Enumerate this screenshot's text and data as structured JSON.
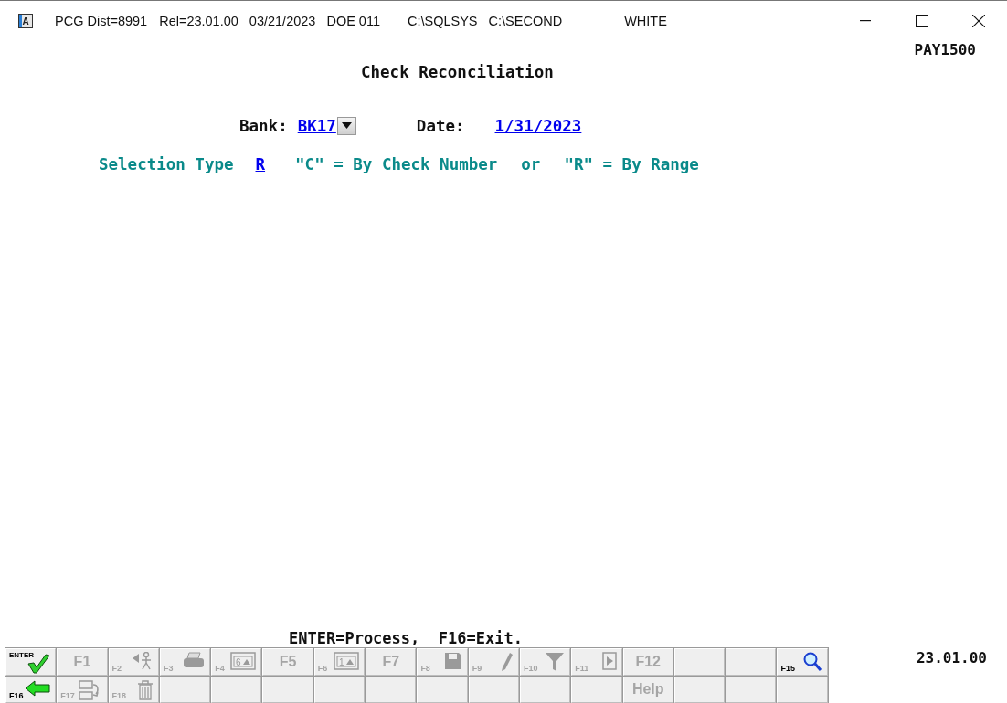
{
  "window": {
    "icon_letter": "A",
    "title_items": [
      "PCG Dist=8991",
      "Rel=23.01.00",
      "03/21/2023",
      "DOE 011",
      "C:\\SQLSYS",
      "C:\\SECOND",
      "WHITE"
    ]
  },
  "screen": {
    "program_code": "PAY1500",
    "title": "Check Reconciliation",
    "bank": {
      "label": "Bank:",
      "value": "BK17"
    },
    "date": {
      "label": "Date:",
      "value": "1/31/2023"
    },
    "selection": {
      "label": "Selection Type",
      "value": "R",
      "hints": [
        "\"C\" = By Check Number",
        "or",
        "\"R\" = By Range"
      ]
    }
  },
  "message": "ENTER=Process,  F16=Exit.",
  "version": "23.01.00",
  "function_keys": [
    [
      {
        "kind": "icon",
        "label": "ENTER",
        "disabled": false
      },
      {
        "kind": "text",
        "label": "F1",
        "disabled": true
      },
      {
        "kind": "icon",
        "label": "F2",
        "disabled": true
      },
      {
        "kind": "icon",
        "label": "F3",
        "disabled": true
      },
      {
        "kind": "icon",
        "label": "F4",
        "badge": "6",
        "disabled": true
      },
      {
        "kind": "text",
        "label": "F5",
        "disabled": true
      },
      {
        "kind": "icon",
        "label": "F6",
        "badge": "1",
        "disabled": true
      },
      {
        "kind": "text",
        "label": "F7",
        "disabled": true
      },
      {
        "kind": "icon",
        "label": "F8",
        "disabled": true
      },
      {
        "kind": "icon",
        "label": "F9",
        "disabled": true
      },
      {
        "kind": "icon",
        "label": "F10",
        "disabled": true
      },
      {
        "kind": "icon",
        "label": "F11",
        "disabled": true
      },
      {
        "kind": "text",
        "label": "F12",
        "disabled": true
      },
      {
        "kind": "blank"
      },
      {
        "kind": "blank"
      },
      {
        "kind": "icon",
        "label": "F15",
        "disabled": false
      }
    ],
    [
      {
        "kind": "icon",
        "label": "F16",
        "disabled": false
      },
      {
        "kind": "icon",
        "label": "F17",
        "disabled": true
      },
      {
        "kind": "icon",
        "label": "F18",
        "disabled": true
      },
      {
        "kind": "blank"
      },
      {
        "kind": "blank"
      },
      {
        "kind": "blank"
      },
      {
        "kind": "blank"
      },
      {
        "kind": "blank"
      },
      {
        "kind": "blank"
      },
      {
        "kind": "blank"
      },
      {
        "kind": "blank"
      },
      {
        "kind": "blank"
      },
      {
        "kind": "text",
        "label": "Help",
        "disabled": true
      },
      {
        "kind": "blank"
      },
      {
        "kind": "blank"
      },
      {
        "kind": "blank"
      }
    ]
  ]
}
